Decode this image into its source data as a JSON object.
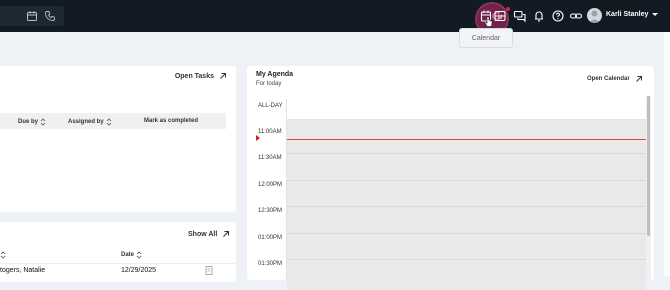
{
  "user": {
    "name": "Karli Stanley"
  },
  "tooltip": {
    "text": "Calendar"
  },
  "tasks_card": {
    "link": "Open Tasks",
    "columns": [
      "Due by",
      "Assigned by",
      "Mark as completed"
    ]
  },
  "recent_card": {
    "link": "Show All",
    "columns": [
      "Date"
    ],
    "rows": [
      {
        "name": "togers, Natalie",
        "date": "12/29/2025"
      }
    ]
  },
  "agenda": {
    "title": "My Agenda",
    "subtitle": "For today",
    "link": "Open Calendar",
    "allday": "ALL-DAY",
    "times": [
      "11:00AM",
      "11:30AM",
      "12:00PM",
      "12:30PM",
      "01:00PM",
      "01:30PM"
    ]
  },
  "colors": {
    "topbar": "#121a24",
    "accent_highlight": "#c8286e",
    "current_time_line": "#d64545",
    "background": "#eef1f5"
  },
  "icons": {
    "search": [
      "calendar-icon",
      "phone-icon"
    ],
    "topbar": [
      "megaphone-icon",
      "calendar-icon",
      "inbox-icon",
      "chat-icon",
      "bell-icon",
      "help-icon",
      "link-icon"
    ]
  }
}
